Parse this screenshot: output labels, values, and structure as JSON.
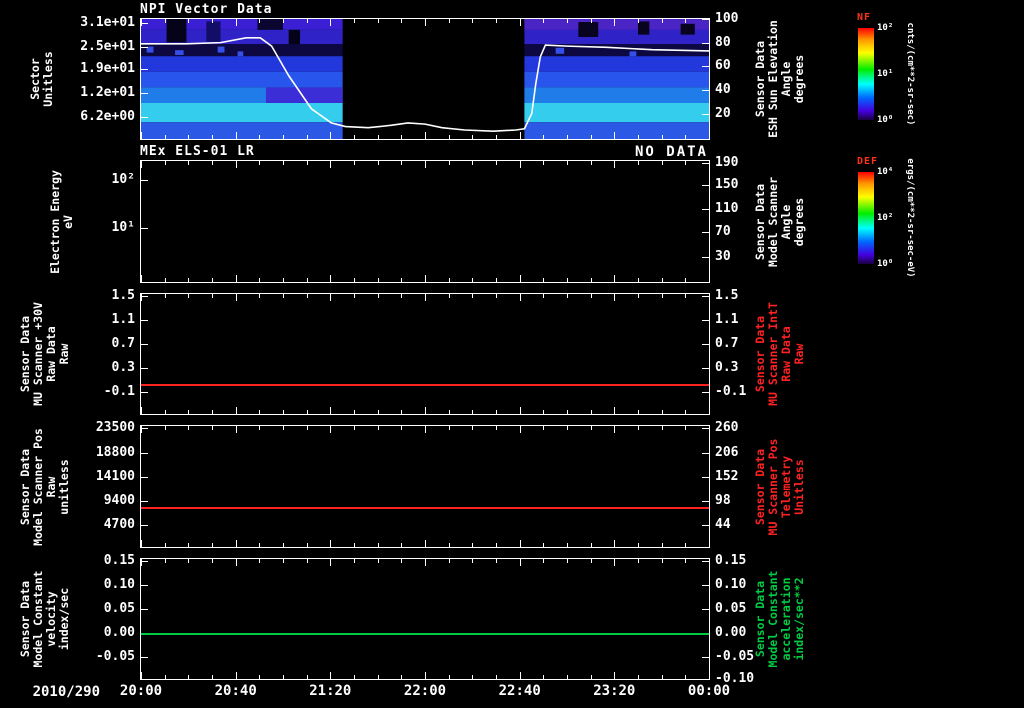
{
  "figure": {
    "background": "#000000",
    "foreground": "#ffffff",
    "red_accent": "#ff2222",
    "green_accent": "#00cc44",
    "colorbar_title_color": "#ff3318"
  },
  "chart_data": {
    "type": "heatmap",
    "xaxis": {
      "date_label": "2010/290",
      "tick_labels": [
        "20:00",
        "20:40",
        "21:20",
        "22:00",
        "22:40",
        "23:20",
        "00:00"
      ],
      "range": "2010/290 20:00 to 2010/291 00:00"
    },
    "panels": [
      {
        "title": "NPI Vector Data",
        "left_label": "Sector\nUnitless",
        "right_label": "Sensor Data\nESH Sun Elevation\nAngle\ndegrees",
        "right_label_color": "#ffffff",
        "left_ticks": [
          {
            "label": "3.1e+01",
            "f": 0.03
          },
          {
            "label": "2.5e+01",
            "f": 0.23
          },
          {
            "label": "1.9e+01",
            "f": 0.42
          },
          {
            "label": "1.2e+01",
            "f": 0.62
          },
          {
            "label": "6.2e+00",
            "f": 0.82
          }
        ],
        "right_ticks": [
          {
            "label": "100",
            "f": 0.0
          },
          {
            "label": "80",
            "f": 0.2
          },
          {
            "label": "60",
            "f": 0.39
          },
          {
            "label": "40",
            "f": 0.59
          },
          {
            "label": "20",
            "f": 0.79
          }
        ],
        "heatmap": {
          "description": "NPI sector counts spectrogram; data 20:00-21:25 and 22:45-00:00, gap in between",
          "blocks": [
            {
              "x": 0.0,
              "w": 0.355
            },
            {
              "x": 0.675,
              "w": 0.325
            }
          ],
          "rows": [
            {
              "y": 0.0,
              "h": 0.09,
              "c": "#3a1fd4"
            },
            {
              "y": 0.09,
              "h": 0.12,
              "c": "#2f23c8"
            },
            {
              "y": 0.21,
              "h": 0.1,
              "c": "#0d0742"
            },
            {
              "y": 0.31,
              "h": 0.13,
              "c": "#2338dc"
            },
            {
              "y": 0.44,
              "h": 0.13,
              "c": "#2856ec"
            },
            {
              "y": 0.57,
              "h": 0.13,
              "c": "#1f7ce8"
            },
            {
              "y": 0.7,
              "h": 0.16,
              "c": "#35cdee"
            },
            {
              "y": 0.86,
              "h": 0.14,
              "c": "#2b58e4"
            }
          ],
          "patches": [
            {
              "x": 0.045,
              "y": 0.0,
              "w": 0.035,
              "h": 0.195,
              "c": "#05031a"
            },
            {
              "x": 0.115,
              "y": 0.02,
              "w": 0.025,
              "h": 0.17,
              "c": "#120d66"
            },
            {
              "x": 0.205,
              "y": 0.0,
              "w": 0.045,
              "h": 0.09,
              "c": "#0a0630"
            },
            {
              "x": 0.26,
              "y": 0.09,
              "w": 0.02,
              "h": 0.12,
              "c": "#05031a"
            },
            {
              "x": 0.22,
              "y": 0.57,
              "w": 0.135,
              "h": 0.13,
              "c": "#3b2ed6"
            },
            {
              "x": 0.675,
              "y": 0.0,
              "w": 0.325,
              "h": 0.09,
              "c": "#4b24c6"
            },
            {
              "x": 0.77,
              "y": 0.025,
              "w": 0.035,
              "h": 0.125,
              "c": "#08041f"
            },
            {
              "x": 0.875,
              "y": 0.02,
              "w": 0.02,
              "h": 0.11,
              "c": "#08041f"
            },
            {
              "x": 0.95,
              "y": 0.04,
              "w": 0.025,
              "h": 0.09,
              "c": "#08041f"
            },
            {
              "x": 0.01,
              "y": 0.23,
              "w": 0.012,
              "h": 0.05,
              "c": "#3550e8"
            },
            {
              "x": 0.06,
              "y": 0.26,
              "w": 0.015,
              "h": 0.04,
              "c": "#3550e8"
            },
            {
              "x": 0.135,
              "y": 0.23,
              "w": 0.012,
              "h": 0.05,
              "c": "#3550e8"
            },
            {
              "x": 0.17,
              "y": 0.27,
              "w": 0.01,
              "h": 0.04,
              "c": "#3550e8"
            },
            {
              "x": 0.73,
              "y": 0.24,
              "w": 0.015,
              "h": 0.05,
              "c": "#3550e8"
            },
            {
              "x": 0.86,
              "y": 0.27,
              "w": 0.012,
              "h": 0.04,
              "c": "#3550e8"
            }
          ]
        },
        "overlay": {
          "name": "ESH Sun Elevation Angle",
          "units": "degrees",
          "color": "#ffffff",
          "points_time_deg": [
            [
              0.0,
              79
            ],
            [
              0.08,
              79
            ],
            [
              0.14,
              80
            ],
            [
              0.185,
              84
            ],
            [
              0.21,
              84
            ],
            [
              0.23,
              77
            ],
            [
              0.26,
              52
            ],
            [
              0.3,
              24
            ],
            [
              0.335,
              12
            ],
            [
              0.36,
              9
            ],
            [
              0.4,
              8
            ],
            [
              0.44,
              10
            ],
            [
              0.47,
              12
            ],
            [
              0.5,
              11
            ],
            [
              0.53,
              8
            ],
            [
              0.57,
              6
            ],
            [
              0.62,
              5
            ],
            [
              0.66,
              6
            ],
            [
              0.675,
              7
            ],
            [
              0.688,
              20
            ],
            [
              0.695,
              45
            ],
            [
              0.703,
              68
            ],
            [
              0.712,
              78
            ],
            [
              0.75,
              77
            ],
            [
              0.82,
              76
            ],
            [
              0.9,
              74
            ],
            [
              1.0,
              73
            ]
          ]
        }
      },
      {
        "title": "MEx ELS-01 LR",
        "corner_note": "NO DATA",
        "left_label": "Electron Energy\neV",
        "right_label": "Sensor Data\nModel Scanner\nAngle\ndegrees",
        "right_label_color": "#ffffff",
        "left_ticks": [
          {
            "label": "10²",
            "f": 0.16
          },
          {
            "label": "10¹",
            "f": 0.55
          }
        ],
        "right_ticks": [
          {
            "label": "190",
            "f": 0.02
          },
          {
            "label": "150",
            "f": 0.2
          },
          {
            "label": "110",
            "f": 0.4
          },
          {
            "label": "70",
            "f": 0.59
          },
          {
            "label": "30",
            "f": 0.79
          }
        ]
      },
      {
        "left_label": "Sensor Data\nMU Scanner +30V\nRaw Data\nRaw",
        "right_label": "Sensor Data\nMU Scanner IntT\nRaw Data\nRaw",
        "right_label_color": "#ff2222",
        "left_ticks": [
          {
            "label": "1.5",
            "f": 0.02
          },
          {
            "label": "1.1",
            "f": 0.22
          },
          {
            "label": "0.7",
            "f": 0.42
          },
          {
            "label": "0.3",
            "f": 0.62
          },
          {
            "label": "-0.1",
            "f": 0.82
          }
        ],
        "right_ticks": [
          {
            "label": "1.5",
            "f": 0.02
          },
          {
            "label": "1.1",
            "f": 0.22
          },
          {
            "label": "0.7",
            "f": 0.42
          },
          {
            "label": "0.3",
            "f": 0.62
          },
          {
            "label": "-0.1",
            "f": 0.82
          }
        ],
        "line": {
          "color": "#ff2222",
          "value": 0.0,
          "f": 0.75
        }
      },
      {
        "left_label": "Sensor Data\nModel Scanner Pos\nRaw\nunitless",
        "right_label": "Sensor Data\nMU Scanner Pos\nTelemetry\nUnitless",
        "right_label_color": "#ff2222",
        "left_ticks": [
          {
            "label": "23500",
            "f": 0.02
          },
          {
            "label": "18800",
            "f": 0.22
          },
          {
            "label": "14100",
            "f": 0.42
          },
          {
            "label": "9400",
            "f": 0.62
          },
          {
            "label": "4700",
            "f": 0.82
          }
        ],
        "right_ticks": [
          {
            "label": "260",
            "f": 0.02
          },
          {
            "label": "206",
            "f": 0.22
          },
          {
            "label": "152",
            "f": 0.42
          },
          {
            "label": "98",
            "f": 0.62
          },
          {
            "label": "44",
            "f": 0.82
          }
        ],
        "line": {
          "color": "#ff2222",
          "value": 8250,
          "f": 0.67
        }
      },
      {
        "left_label": "Sensor Data\nModel Constant\nvelocity\nindex/sec",
        "right_label": "Sensor Data\nModel Constant\nacceleration\nindex/sec**2",
        "right_label_color": "#00cc44",
        "left_ticks": [
          {
            "label": "0.15",
            "f": 0.02
          },
          {
            "label": "0.10",
            "f": 0.22
          },
          {
            "label": "0.05",
            "f": 0.42
          },
          {
            "label": "0.00",
            "f": 0.62
          },
          {
            "label": "-0.05",
            "f": 0.82
          }
        ],
        "right_ticks": [
          {
            "label": "0.15",
            "f": 0.02
          },
          {
            "label": "0.10",
            "f": 0.22
          },
          {
            "label": "0.05",
            "f": 0.42
          },
          {
            "label": "0.00",
            "f": 0.62
          },
          {
            "label": "-0.05",
            "f": 0.82
          },
          {
            "label": "-0.10",
            "f": 1.0
          }
        ],
        "line": {
          "color": "#00cc44",
          "value": 0.0,
          "f": 0.62
        }
      }
    ]
  },
  "colorbars": [
    {
      "name": "NF",
      "unit": "cnts/(cm**2-sr-sec)",
      "ticks": [
        {
          "label": "10²",
          "f": 0.0
        },
        {
          "label": "10¹",
          "f": 0.5
        },
        {
          "label": "10⁰",
          "f": 1.0
        }
      ]
    },
    {
      "name": "DEF",
      "unit": "ergs/(cm**2-sr-sec-eV)",
      "ticks": [
        {
          "label": "10⁴",
          "f": 0.0
        },
        {
          "label": "10²",
          "f": 0.5
        },
        {
          "label": "10⁰",
          "f": 1.0
        }
      ]
    }
  ]
}
